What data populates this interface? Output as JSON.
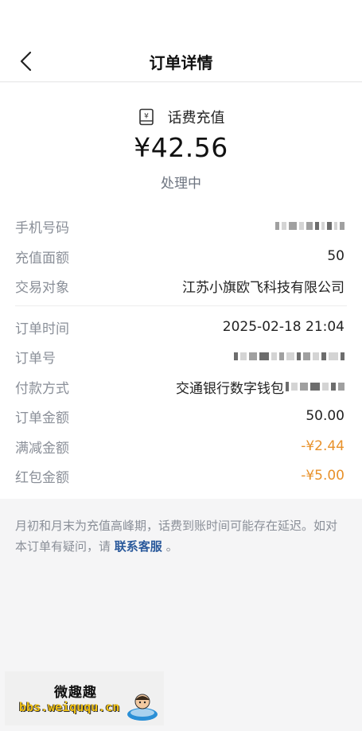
{
  "nav": {
    "title": "订单详情",
    "back_icon": "chevron-left-icon"
  },
  "product": {
    "icon": "phone-bill-icon",
    "name": "话费充值"
  },
  "amount": "¥42.56",
  "status": "处理中",
  "details_top": [
    {
      "key": "phone",
      "label": "手机号码",
      "value": ""
    },
    {
      "key": "face_value",
      "label": "充值面额",
      "value": "50"
    },
    {
      "key": "counterparty",
      "label": "交易对象",
      "value": "江苏小旗欧飞科技有限公司"
    }
  ],
  "details_bottom": [
    {
      "key": "order_time",
      "label": "订单时间",
      "value": "2025-02-18 21:04"
    },
    {
      "key": "order_no",
      "label": "订单号",
      "value": ""
    },
    {
      "key": "payment",
      "label": "付款方式",
      "value": "交通银行数字钱包"
    },
    {
      "key": "order_amount",
      "label": "订单金额",
      "value": "50.00"
    },
    {
      "key": "full_discount",
      "label": "满减金额",
      "value": "-¥2.44"
    },
    {
      "key": "red_packet",
      "label": "红包金额",
      "value": "-¥5.00"
    }
  ],
  "notice": {
    "text": "月初和月末为充值高峰期，话费到账时间可能存在延迟。如对本订单有疑问，请",
    "link": "联系客服",
    "suffix": "。"
  },
  "watermark": {
    "title": "微趣趣",
    "url": "bbs.weiququ.cn"
  },
  "colors": {
    "discount": "#e8912a",
    "link": "#2b5a9c",
    "label": "#8a8f98",
    "background": "#f5f5f6"
  }
}
